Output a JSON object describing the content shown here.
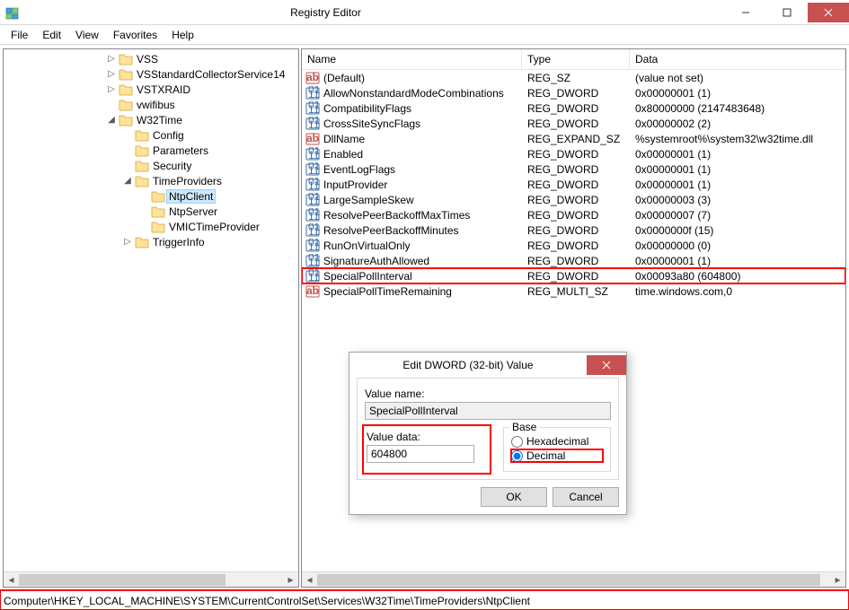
{
  "window": {
    "title": "Registry Editor",
    "buttons": {
      "min": "minimize",
      "max": "maximize",
      "close": "close"
    }
  },
  "menu": [
    "File",
    "Edit",
    "View",
    "Favorites",
    "Help"
  ],
  "tree": {
    "indent_base": 112,
    "nodes": [
      {
        "depth": 0,
        "exp": "▷",
        "label": "VSS"
      },
      {
        "depth": 0,
        "exp": "▷",
        "label": "VSStandardCollectorService14"
      },
      {
        "depth": 0,
        "exp": "▷",
        "label": "VSTXRAID"
      },
      {
        "depth": 0,
        "exp": "",
        "label": "vwifibus"
      },
      {
        "depth": 0,
        "exp": "◢",
        "label": "W32Time"
      },
      {
        "depth": 1,
        "exp": "",
        "label": "Config"
      },
      {
        "depth": 1,
        "exp": "",
        "label": "Parameters"
      },
      {
        "depth": 1,
        "exp": "",
        "label": "Security"
      },
      {
        "depth": 1,
        "exp": "◢",
        "label": "TimeProviders"
      },
      {
        "depth": 2,
        "exp": "",
        "label": "NtpClient",
        "selected": true
      },
      {
        "depth": 2,
        "exp": "",
        "label": "NtpServer"
      },
      {
        "depth": 2,
        "exp": "",
        "label": "VMICTimeProvider"
      },
      {
        "depth": 1,
        "exp": "▷",
        "label": "TriggerInfo"
      }
    ]
  },
  "list": {
    "headers": {
      "name": "Name",
      "type": "Type",
      "data": "Data"
    },
    "rows": [
      {
        "icon": "sz",
        "name": "(Default)",
        "type": "REG_SZ",
        "data": "(value not set)"
      },
      {
        "icon": "dw",
        "name": "AllowNonstandardModeCombinations",
        "type": "REG_DWORD",
        "data": "0x00000001 (1)"
      },
      {
        "icon": "dw",
        "name": "CompatibilityFlags",
        "type": "REG_DWORD",
        "data": "0x80000000 (2147483648)"
      },
      {
        "icon": "dw",
        "name": "CrossSiteSyncFlags",
        "type": "REG_DWORD",
        "data": "0x00000002 (2)"
      },
      {
        "icon": "sz",
        "name": "DllName",
        "type": "REG_EXPAND_SZ",
        "data": "%systemroot%\\system32\\w32time.dll"
      },
      {
        "icon": "dw",
        "name": "Enabled",
        "type": "REG_DWORD",
        "data": "0x00000001 (1)"
      },
      {
        "icon": "dw",
        "name": "EventLogFlags",
        "type": "REG_DWORD",
        "data": "0x00000001 (1)"
      },
      {
        "icon": "dw",
        "name": "InputProvider",
        "type": "REG_DWORD",
        "data": "0x00000001 (1)"
      },
      {
        "icon": "dw",
        "name": "LargeSampleSkew",
        "type": "REG_DWORD",
        "data": "0x00000003 (3)"
      },
      {
        "icon": "dw",
        "name": "ResolvePeerBackoffMaxTimes",
        "type": "REG_DWORD",
        "data": "0x00000007 (7)"
      },
      {
        "icon": "dw",
        "name": "ResolvePeerBackoffMinutes",
        "type": "REG_DWORD",
        "data": "0x0000000f (15)"
      },
      {
        "icon": "dw",
        "name": "RunOnVirtualOnly",
        "type": "REG_DWORD",
        "data": "0x00000000 (0)"
      },
      {
        "icon": "dw",
        "name": "SignatureAuthAllowed",
        "type": "REG_DWORD",
        "data": "0x00000001 (1)"
      },
      {
        "icon": "dw",
        "name": "SpecialPollInterval",
        "type": "REG_DWORD",
        "data": "0x00093a80 (604800)",
        "highlight": true
      },
      {
        "icon": "sz",
        "name": "SpecialPollTimeRemaining",
        "type": "REG_MULTI_SZ",
        "data": "time.windows.com,0"
      }
    ]
  },
  "dialog": {
    "title": "Edit DWORD (32-bit) Value",
    "value_name_lbl": "Value name:",
    "value_name": "SpecialPollInterval",
    "value_data_lbl": "Value data:",
    "value_data": "604800",
    "base_lbl": "Base",
    "hex_lbl": "Hexadecimal",
    "dec_lbl": "Decimal",
    "ok": "OK",
    "cancel": "Cancel"
  },
  "status": "Computer\\HKEY_LOCAL_MACHINE\\SYSTEM\\CurrentControlSet\\Services\\W32Time\\TimeProviders\\NtpClient"
}
